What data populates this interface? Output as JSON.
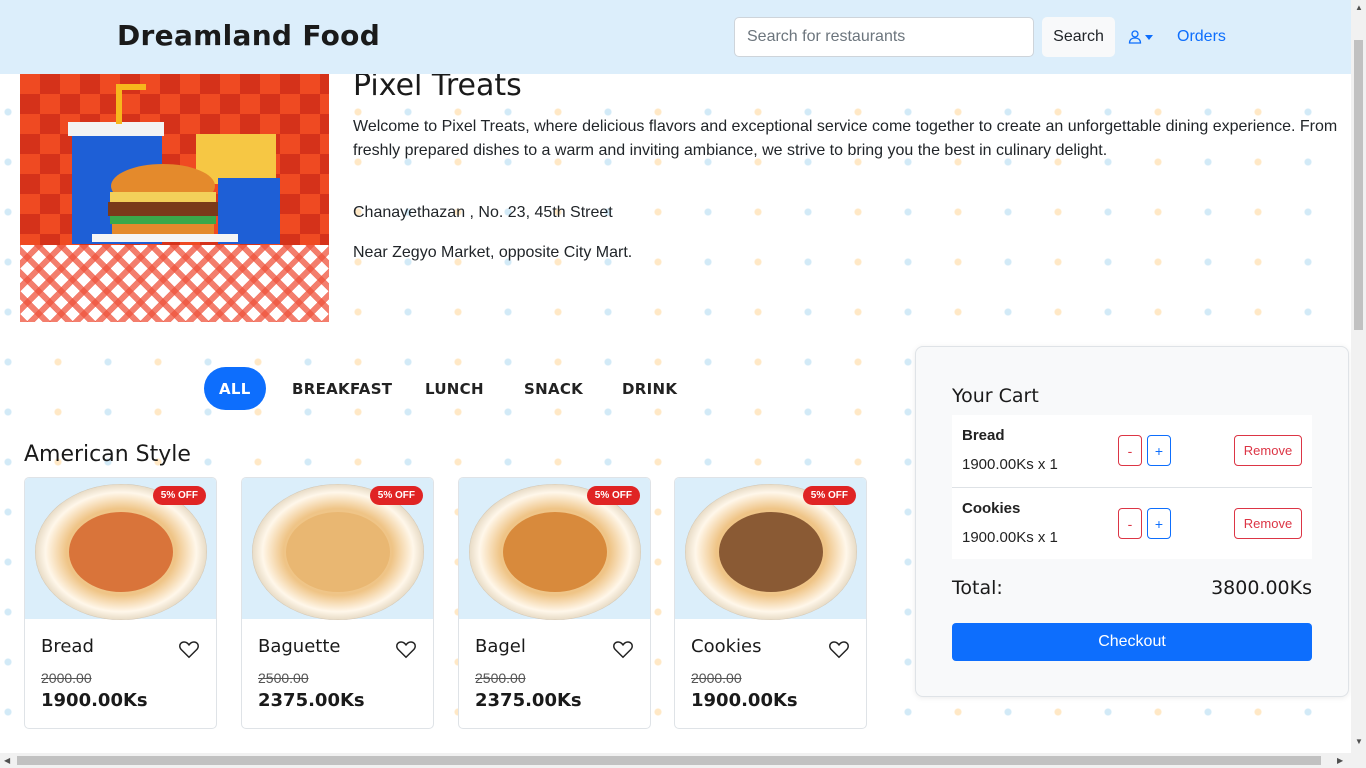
{
  "navbar": {
    "brand": "Dreamland Food",
    "search_placeholder": "Search for restaurants",
    "search_button": "Search",
    "user_icon": "user-icon",
    "orders_link": "Orders"
  },
  "restaurant": {
    "name": "Pixel Treats",
    "description": "Welcome to Pixel Treats, where delicious flavors and exceptional service come together to create an unforgettable dining experience. From freshly prepared dishes to a warm and inviting ambiance, we strive to bring you the best in culinary delight.",
    "address_line1": "Chanayethazan , No. 23, 45th Street",
    "address_line2": "Near Zegyo Market, opposite City Mart."
  },
  "categories": [
    "ALL",
    "BREAKFAST",
    "LUNCH",
    "SNACK",
    "DRINK"
  ],
  "active_category": "ALL",
  "section": {
    "title": "American Style",
    "items": [
      {
        "name": "Bread",
        "badge": "5% OFF",
        "old_price": "2000.00",
        "new_price": "1900.00Ks",
        "food_color": "#d9743a"
      },
      {
        "name": "Baguette",
        "badge": "5% OFF",
        "old_price": "2500.00",
        "new_price": "2375.00Ks",
        "food_color": "#e9b772"
      },
      {
        "name": "Bagel",
        "badge": "5% OFF",
        "old_price": "2500.00",
        "new_price": "2375.00Ks",
        "food_color": "#d88a3c"
      },
      {
        "name": "Cookies",
        "badge": "5% OFF",
        "old_price": "2000.00",
        "new_price": "1900.00Ks",
        "food_color": "#8a5a34"
      }
    ]
  },
  "cart": {
    "title": "Your Cart",
    "items": [
      {
        "name": "Bread",
        "price": "1900.00Ks x 1",
        "minus": "-",
        "plus": "+",
        "remove": "Remove"
      },
      {
        "name": "Cookies",
        "price": "1900.00Ks x 1",
        "minus": "-",
        "plus": "+",
        "remove": "Remove"
      }
    ],
    "total_label": "Total:",
    "total_value": "3800.00Ks",
    "checkout": "Checkout"
  },
  "colors": {
    "primary": "#0d6efd",
    "danger": "#dc3545",
    "navbar_bg": "#dceefb",
    "badge": "#e02424"
  }
}
